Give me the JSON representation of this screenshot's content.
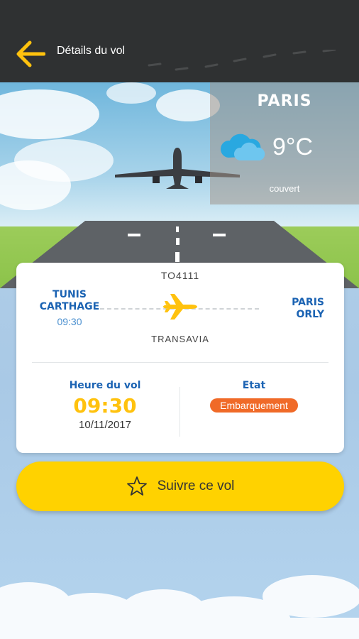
{
  "header": {
    "title": "Détails du vol"
  },
  "weather": {
    "city": "PARIS",
    "temperature": "9°C",
    "description": "couvert",
    "icon": "cloud-rain-icon"
  },
  "flight": {
    "number": "TO4111",
    "from": {
      "city_line1": "TUNIS",
      "city_line2": "CARTHAGE",
      "time": "09:30"
    },
    "to": {
      "city_line1": "PARIS",
      "city_line2": "ORLY"
    },
    "airline": "TRANSAVIA"
  },
  "details": {
    "time_title": "Heure du vol",
    "time": "09:30",
    "date": "10/11/2017",
    "status_title": "Etat",
    "status": "Embarquement"
  },
  "follow_button": {
    "label": "Suivre ce vol"
  },
  "colors": {
    "header": "#2f3132",
    "accent": "#ffd200",
    "primary_blue": "#1b63b3",
    "status": "#f06a28"
  }
}
